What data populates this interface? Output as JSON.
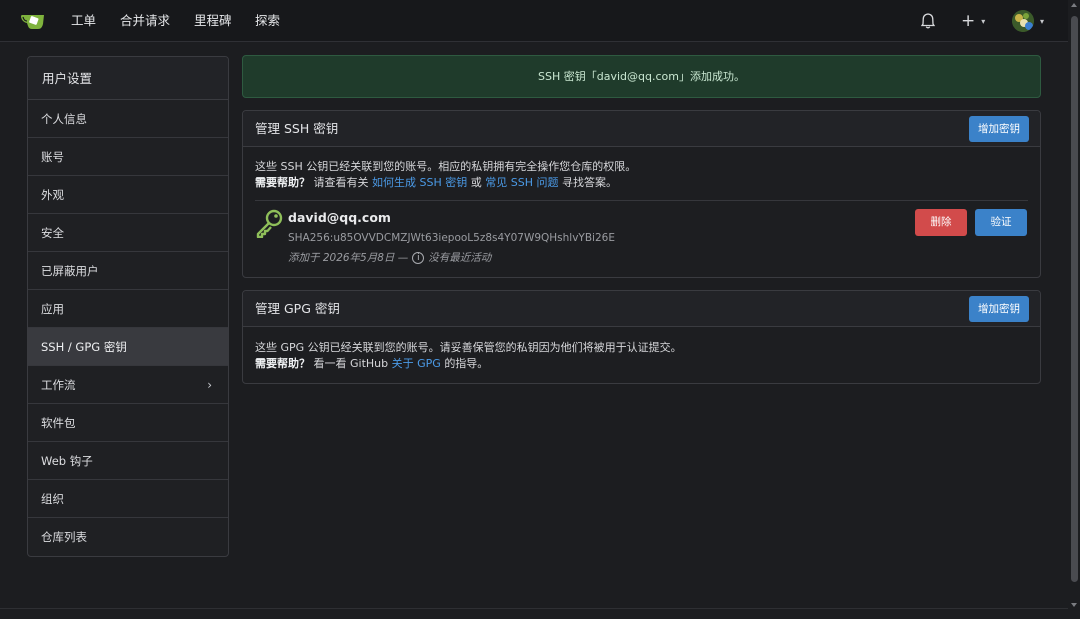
{
  "nav": {
    "items": [
      "工单",
      "合并请求",
      "里程碑",
      "探索"
    ],
    "plus_label": "+",
    "caret": "▾"
  },
  "sidebar": {
    "title": "用户设置",
    "items": [
      {
        "label": "个人信息"
      },
      {
        "label": "账号"
      },
      {
        "label": "外观"
      },
      {
        "label": "安全"
      },
      {
        "label": "已屏蔽用户"
      },
      {
        "label": "应用"
      },
      {
        "label": "SSH / GPG 密钥",
        "active": true
      },
      {
        "label": "工作流",
        "has_children": true
      },
      {
        "label": "软件包"
      },
      {
        "label": "Web 钩子"
      },
      {
        "label": "组织"
      },
      {
        "label": "仓库列表"
      }
    ],
    "chevron": "›"
  },
  "flash": {
    "message": "SSH 密钥「david@qq.com」添加成功。"
  },
  "ssh": {
    "title": "管理 SSH 密钥",
    "add_button": "增加密钥",
    "desc_line1": "这些 SSH 公钥已经关联到您的账号。相应的私钥拥有完全操作您仓库的权限。",
    "help_label": "需要帮助？",
    "help_text1": "请查看有关",
    "help_link1": "如何生成 SSH 密钥",
    "help_text2": "或",
    "help_link2": "常见 SSH 问题",
    "help_text3": "寻找答案。",
    "key": {
      "name": "david@qq.com",
      "fingerprint": "SHA256:u85OVVDCMZJWt63iepooL5z8s4Y07W9QHshlvYBi26E",
      "added": "添加于 2026年5月8日 —",
      "activity": "没有最近活动",
      "delete_button": "删除",
      "verify_button": "验证"
    }
  },
  "gpg": {
    "title": "管理 GPG 密钥",
    "add_button": "增加密钥",
    "desc_line1": "这些 GPG 公钥已经关联到您的账号。请妥善保管您的私钥因为他们将被用于认证提交。",
    "help_label": "需要帮助？",
    "help_text1": "看一看 GitHub",
    "help_link1": "关于 GPG",
    "help_text2": "的指导。"
  },
  "colors": {
    "accent": "#3b82c9",
    "danger": "#d24b4b",
    "success_bg": "#1f3b2b",
    "link": "#4b9ae6",
    "key_icon": "#8fbf5a"
  }
}
